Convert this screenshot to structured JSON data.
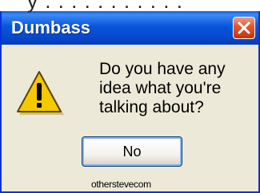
{
  "background_fragment": "y . . . . . . . . . . .",
  "dialog": {
    "title": "Dumbass",
    "close_icon": "close-icon",
    "warning_icon": "warning-icon",
    "message_lines": [
      "Do you have any",
      "idea what you're",
      "talking about?"
    ],
    "button_label": "No",
    "watermark": "otherstevecom"
  },
  "colors": {
    "titlebar": "#0a55db",
    "window_body": "#ece9d8",
    "close_button": "#e2542c",
    "warning_yellow": "#f6c800"
  }
}
